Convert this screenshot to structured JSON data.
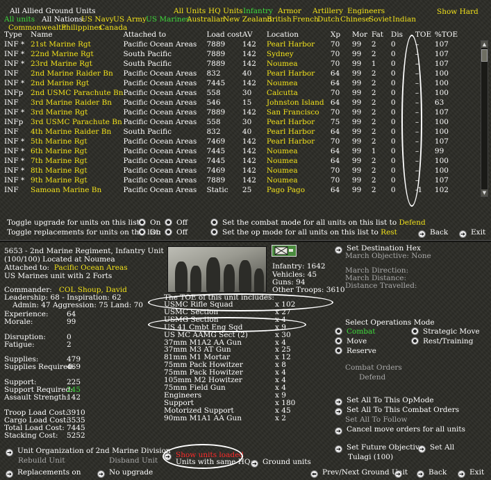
{
  "header": {
    "title": "All Allied Ground Units",
    "tabs_row1": [
      "All Units",
      "HQ Units",
      "Infantry",
      "Armor",
      "Artillery",
      "Engineers"
    ],
    "show_hard": "Show Hard",
    "all_units": "All units",
    "all_nations": "All Nations:",
    "nations_row1": [
      "US Navy",
      "US Army",
      "US Marines",
      "Australian",
      "New Zealand",
      "British",
      "French",
      "Dutch",
      "Chinese",
      "Soviet",
      "Indian"
    ],
    "nations_row2": [
      "Commonwealth",
      "Philippines",
      "Canada"
    ]
  },
  "table": {
    "headers": [
      "Type",
      "Name",
      "Attached to",
      "Load cost",
      "AV",
      "Location",
      "Xp",
      "Mor",
      "Fat",
      "Dis",
      "TOE",
      "%TOE"
    ],
    "rows": [
      {
        "type": "INF *",
        "name": "21st Marine Rgt",
        "attached": "Pacific Ocean Areas",
        "load": "7889",
        "av": "142",
        "location": "Pearl Harbor",
        "xp": "70",
        "mor": "99",
        "fat": "2",
        "dis": "0",
        "toe": "–",
        "ptoe": "107"
      },
      {
        "type": "INF *",
        "name": "22nd Marine Rgt",
        "attached": "South Pacific",
        "load": "7889",
        "av": "142",
        "location": "Sydney",
        "xp": "70",
        "mor": "99",
        "fat": "2",
        "dis": "0",
        "toe": "–",
        "ptoe": "107"
      },
      {
        "type": "INF *",
        "name": "23rd Marine Rgt",
        "attached": "South Pacific",
        "load": "7889",
        "av": "142",
        "location": "Noumea",
        "xp": "70",
        "mor": "99",
        "fat": "1",
        "dis": "0",
        "toe": "–",
        "ptoe": "107"
      },
      {
        "type": "INF",
        "name": "2nd Marine Raider Bn",
        "attached": "Pacific Ocean Areas",
        "load": "832",
        "av": "40",
        "location": "Pearl Harbor",
        "xp": "64",
        "mor": "99",
        "fat": "2",
        "dis": "0",
        "toe": "–",
        "ptoe": "100"
      },
      {
        "type": "INF *",
        "name": "2nd Marine Rgt",
        "attached": "Pacific Ocean Areas",
        "load": "7445",
        "av": "142",
        "location": "Noumea",
        "xp": "64",
        "mor": "99",
        "fat": "2",
        "dis": "0",
        "toe": "–",
        "ptoe": "100"
      },
      {
        "type": "INFp",
        "name": "2nd USMC Parachute Bn",
        "attached": "Pacific Ocean Areas",
        "load": "558",
        "av": "30",
        "location": "Calcutta",
        "xp": "70",
        "mor": "99",
        "fat": "2",
        "dis": "0",
        "toe": "–",
        "ptoe": "100"
      },
      {
        "type": "INF",
        "name": "3rd Marine Raider Bn",
        "attached": "Pacific Ocean Areas",
        "load": "546",
        "av": "15",
        "location": "Johnston Island",
        "xp": "64",
        "mor": "99",
        "fat": "2",
        "dis": "0",
        "toe": "–",
        "ptoe": "63"
      },
      {
        "type": "INF *",
        "name": "3rd Marine Rgt",
        "attached": "Pacific Ocean Areas",
        "load": "7889",
        "av": "142",
        "location": "San Francisco",
        "xp": "70",
        "mor": "99",
        "fat": "2",
        "dis": "0",
        "toe": "–",
        "ptoe": "107"
      },
      {
        "type": "INFp",
        "name": "3rd USMC Parachute Bn",
        "attached": "Pacific Ocean Areas",
        "load": "558",
        "av": "30",
        "location": "Pearl Harbor",
        "xp": "75",
        "mor": "99",
        "fat": "2",
        "dis": "0",
        "toe": "–",
        "ptoe": "100"
      },
      {
        "type": "INF",
        "name": "4th Marine Raider Bn",
        "attached": "South Pacific",
        "load": "832",
        "av": "40",
        "location": "Pearl Harbor",
        "xp": "64",
        "mor": "99",
        "fat": "2",
        "dis": "0",
        "toe": "–",
        "ptoe": "100"
      },
      {
        "type": "INF *",
        "name": "5th Marine Rgt",
        "attached": "Pacific Ocean Areas",
        "load": "7469",
        "av": "142",
        "location": "Pearl Harbor",
        "xp": "70",
        "mor": "99",
        "fat": "2",
        "dis": "0",
        "toe": "–",
        "ptoe": "107"
      },
      {
        "type": "INF *",
        "name": "6th Marine Rgt",
        "attached": "Pacific Ocean Areas",
        "load": "7445",
        "av": "142",
        "location": "Noumea",
        "xp": "64",
        "mor": "99",
        "fat": "1",
        "dis": "0",
        "toe": "–",
        "ptoe": "99"
      },
      {
        "type": "INF *",
        "name": "7th Marine Rgt",
        "attached": "Pacific Ocean Areas",
        "load": "7445",
        "av": "142",
        "location": "Noumea",
        "xp": "64",
        "mor": "99",
        "fat": "2",
        "dis": "0",
        "toe": "–",
        "ptoe": "100"
      },
      {
        "type": "INF *",
        "name": "8th Marine Rgt",
        "attached": "Pacific Ocean Areas",
        "load": "7469",
        "av": "142",
        "location": "Noumea",
        "xp": "70",
        "mor": "99",
        "fat": "2",
        "dis": "0",
        "toe": "–",
        "ptoe": "100"
      },
      {
        "type": "INF *",
        "name": "9th Marine Rgt",
        "attached": "Pacific Ocean Areas",
        "load": "7889",
        "av": "142",
        "location": "Noumea",
        "xp": "70",
        "mor": "99",
        "fat": "2",
        "dis": "0",
        "toe": "–",
        "ptoe": "107"
      },
      {
        "type": "INF",
        "name": "Samoan Marine Bn",
        "attached": "Pacific Ocean Areas",
        "load": "Static",
        "av": "25",
        "location": "Pago Pago",
        "xp": "64",
        "mor": "99",
        "fat": "2",
        "dis": "0",
        "toe": "-1",
        "ptoe": "102"
      }
    ]
  },
  "toggles": {
    "upgrade_label": "Toggle upgrade for units on this list:",
    "replacements_label": "Toggle replacements for units on this list:",
    "on": "On",
    "off": "Off",
    "combat_mode_label": "Set the combat mode for all units on this list to",
    "combat_mode_value": "Defend",
    "op_mode_label": "Set the op mode for all units on this list to",
    "op_mode_value": "Rest",
    "back": "Back",
    "exit": "Exit"
  },
  "detail": {
    "id_line": "5653 - 2nd Marine Regiment, Infantry Unit",
    "strength_line": "(100/100) Located at Noumea",
    "attached_label": "Attached to:",
    "attached_value": "Pacific Ocean Areas",
    "forts_line": "US Marines unit with 2 Forts",
    "commander_label": "Commander:",
    "commander_value": "COL Shoup, David",
    "leadership_line": "Leadership: 68 - Inspiration: 62",
    "admin_line": "Admin: 47  Aggression: 75  Land: 70",
    "stats": [
      {
        "label": "Experience:",
        "value": "64"
      },
      {
        "label": "Morale:",
        "value": "99"
      },
      {
        "label": "Disruption:",
        "value": "0"
      },
      {
        "label": "Fatigue:",
        "value": "2"
      },
      {
        "label": "Supplies:",
        "value": "479"
      },
      {
        "label": "Supplies Required:",
        "value": "469"
      },
      {
        "label": "Support:",
        "value": "225"
      },
      {
        "label": "Support Required:",
        "value": "245"
      },
      {
        "label": "Assault Strength:",
        "value": "142"
      },
      {
        "label": "Troop Load Cost:",
        "value": "3910"
      },
      {
        "label": "Cargo Load Cost:",
        "value": "3535"
      },
      {
        "label": "Total Load Cost:",
        "value": "7445"
      },
      {
        "label": "Stacking Cost:",
        "value": "5252"
      }
    ]
  },
  "composition": {
    "infantry": "Infantry: 1642",
    "vehicles": "Vehicles: 45",
    "guns": "Guns: 94",
    "other": "Other Troops: 3610"
  },
  "toe": {
    "title": "The TOE of this unit includes:",
    "items": [
      {
        "name": "USMC Rifle Squad",
        "count": "x 102"
      },
      {
        "name": "USMC Section",
        "count": "x 27"
      },
      {
        "name": "USMG Section",
        "count": "x 4"
      },
      {
        "name": "US 41 Cmbt Eng Sqd",
        "count": "x 9"
      },
      {
        "name": "US MC AAMG Sect (2)",
        "count": "x 30"
      },
      {
        "name": "37mm M1A2 AA Gun",
        "count": "x 4"
      },
      {
        "name": "37mm M3 AT Gun",
        "count": "x 25"
      },
      {
        "name": "81mm M1 Mortar",
        "count": "x 12"
      },
      {
        "name": "75mm Pack Howitzer",
        "count": "x 8"
      },
      {
        "name": "75mm Pack Howitzer",
        "count": "x 4"
      },
      {
        "name": "105mm M2 Howitzer",
        "count": "x 4"
      },
      {
        "name": "75mm Field Gun",
        "count": "x 4"
      },
      {
        "name": "Engineers",
        "count": "x 9"
      },
      {
        "name": "Support",
        "count": "x 180"
      },
      {
        "name": "Motorized Support",
        "count": "x 45"
      },
      {
        "name": "90mm M1A1 AA Gun",
        "count": "x 2"
      }
    ]
  },
  "orders": {
    "set_destination": "Set Destination Hex",
    "march_objective": "March Objective: None",
    "march_direction": "March Direction:",
    "march_distance": "March Distance:",
    "distance_travelled": "Distance Travelled:",
    "select_ops_mode": "Select Operations Mode",
    "combat": "Combat",
    "strategic_move": "Strategic Move",
    "move": "Move",
    "rest_training": "Rest/Training",
    "reserve": "Reserve",
    "combat_orders": "Combat Orders",
    "defend": "Defend",
    "set_all_opmode": "Set All To This OpMode",
    "set_all_combat": "Set All To This Combat Orders",
    "set_all_follow": "Set All To Follow",
    "cancel_move": "Cancel move orders for all units",
    "set_future_objective": "Set Future Objective",
    "set_all": "Set All",
    "objective_value": "Tulagi (100)"
  },
  "bottom": {
    "unit_org": "Unit Organization of 2nd Marine Division",
    "rebuild": "Rebuild Unit",
    "disband": "Disband Unit",
    "show_units_loaded": "Show units loaded",
    "same_hq": "Units with same HQ:",
    "ground_units": "Ground units",
    "replacements_on": "Replacements on",
    "no_upgrade": "No upgrade",
    "prev_next": "Prev/Next Ground Unit",
    "back": "Back",
    "exit": "Exit"
  },
  "colors": {
    "yellow": "#f2e21b",
    "green": "#3fdc3c",
    "red": "#ff2a2a",
    "background": "#2b2b26"
  }
}
